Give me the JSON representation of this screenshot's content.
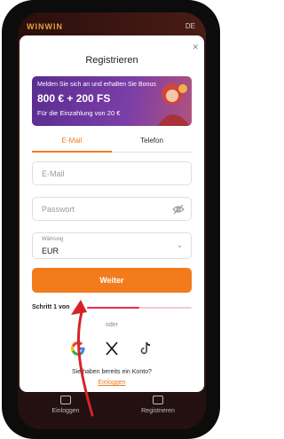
{
  "app": {
    "logo": "WINWIN",
    "lang": "DE",
    "bottom_nav": {
      "left": "Einloggen",
      "right": "Registrieren"
    }
  },
  "modal": {
    "title": "Registrieren",
    "banner": {
      "line1": "Melden Sie sich an und erhalten Sie Bonus",
      "line2": "800 € + 200 FS",
      "line3": "Für die Einzahlung von 20 €"
    },
    "tabs": {
      "email": "E-Mail",
      "phone": "Telefon"
    },
    "fields": {
      "email_placeholder": "E-Mail",
      "password_placeholder": "Passwort",
      "currency_caption": "Währung",
      "currency_value": "EUR"
    },
    "submit_label": "Weiter",
    "step_label": "Schritt 1 von",
    "step_progress": 0.5,
    "or_label": "oder",
    "question": "Sie haben bereits ein Konto?",
    "login_link": "Einloggen"
  },
  "colors": {
    "accent": "#f27b1c",
    "progress": "#e2304a",
    "arrow": "#d6232a"
  }
}
